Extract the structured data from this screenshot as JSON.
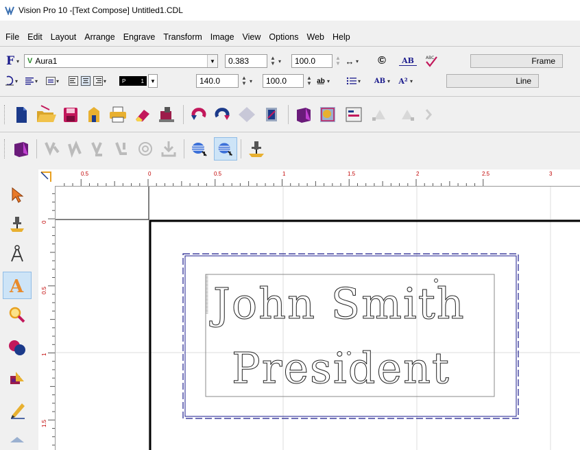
{
  "window": {
    "title": "Vision Pro 10 -[Text Compose] Untitled1.CDL"
  },
  "menu": [
    "File",
    "Edit",
    "Layout",
    "Arrange",
    "Engrave",
    "Transform",
    "Image",
    "View",
    "Options",
    "Web",
    "Help"
  ],
  "text_toolbar": {
    "font_prefix": "F",
    "font_type_marker": "V",
    "font_name": "Aura1",
    "height_value": "0.383",
    "width_percent": "100.0",
    "angle_value": "140.0",
    "spacing_percent": "100.0",
    "color_swatch_label": "P",
    "color_swatch_number": "1",
    "copyright_symbol": "©",
    "ab_label": "AB",
    "ab_super_label": "AB",
    "a_squared_label": "A²",
    "frame_button": "Frame",
    "line_button": "Line"
  },
  "ruler": {
    "h_labels": [
      "0.5",
      "0",
      "0.5",
      "1",
      "1.5",
      "2",
      "2.5",
      "3"
    ],
    "v_labels": [
      "0",
      "0.5",
      "1",
      "1.5"
    ]
  },
  "document": {
    "line1": "John Smith",
    "line2": "President"
  },
  "colors": {
    "ruler_label": "#c00000",
    "selection_border": "#1a1a8c",
    "active_tool_bg": "#cde4f7"
  },
  "icons": {
    "main_toolbar": [
      "new-icon",
      "open-icon",
      "save-icon",
      "template-icon",
      "print-icon",
      "eraser-icon",
      "engrave-machine-icon",
      "undo-icon",
      "redo-icon",
      "diamond-icon",
      "scan-icon",
      "layer-icon",
      "image-icon",
      "properties-icon",
      "node-icon",
      "node2-icon",
      "more-icon"
    ],
    "secondary_toolbar": [
      "layer-icon",
      "weld-icon",
      "weld2-icon",
      "weld3-icon",
      "weld4-icon",
      "target-icon",
      "import-icon",
      "fill-stripes-icon",
      "fill-stripes-active-icon",
      "engraver-icon"
    ],
    "left_tools": [
      "arrow-icon",
      "engraver-icon",
      "pen-compass-icon",
      "text-tool-icon",
      "zoom-icon",
      "shapes-icon",
      "transform-icon",
      "pencil-icon",
      "more-icon"
    ]
  }
}
